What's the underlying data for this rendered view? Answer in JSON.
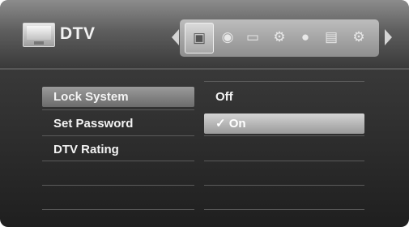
{
  "header": {
    "title": "DTV",
    "tv_badge_text": "DTV",
    "nav_icons": [
      "tv-icon",
      "speaker-icon",
      "monitor-icon",
      "settings-gears-icon",
      "globe-icon",
      "lock-box-icon",
      "gear-icon"
    ],
    "active_icon": "tv-icon"
  },
  "menu": {
    "items": [
      {
        "label": "Lock System",
        "selected": true
      },
      {
        "label": "Set Password",
        "selected": false
      },
      {
        "label": "DTV Rating",
        "selected": false
      }
    ]
  },
  "options": {
    "items": [
      {
        "label": "Off",
        "selected": false
      },
      {
        "label": "✓ On",
        "selected": true
      }
    ]
  }
}
